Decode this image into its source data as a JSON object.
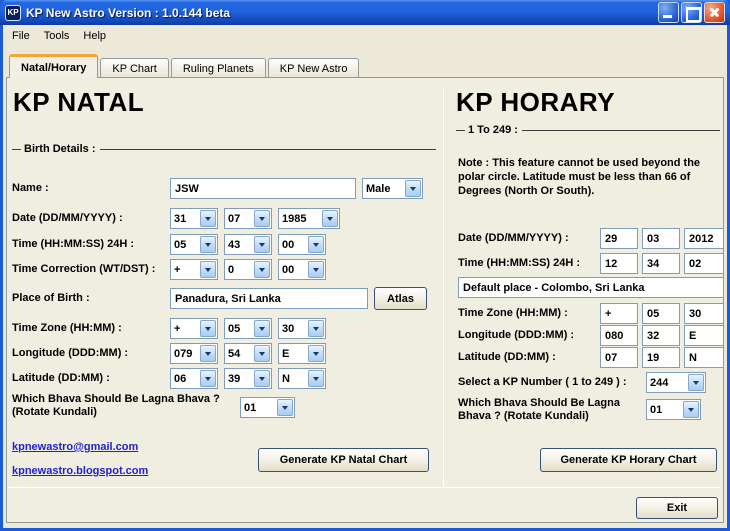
{
  "colors": {
    "titlebar_blue": "#1C5BD8",
    "window_bg": "#ECE9D8",
    "close_red": "#D6492B",
    "link_blue": "#2121CE",
    "textbox_border": "#7F9DB9"
  },
  "window": {
    "icon": "KP",
    "title": "KP New Astro Version : 1.0.144 beta"
  },
  "menu": {
    "items": [
      "File",
      "Tools",
      "Help"
    ]
  },
  "tabs": [
    {
      "label": "Natal/Horary"
    },
    {
      "label": "KP Chart"
    },
    {
      "label": "Ruling Planets"
    },
    {
      "label": "KP New Astro"
    }
  ],
  "natal": {
    "heading": "KP NATAL",
    "group": "Birth Details :",
    "name": {
      "label": "Name :",
      "value": "JSW"
    },
    "gender": {
      "value": "Male"
    },
    "date": {
      "label": "Date (DD/MM/YYYY) :",
      "values": [
        "31",
        "07",
        "1985"
      ]
    },
    "time": {
      "label": "Time (HH:MM:SS) 24H :",
      "values": [
        "05",
        "43",
        "00"
      ]
    },
    "correction": {
      "label": "Time Correction (WT/DST) :",
      "values": [
        "+",
        "0",
        "00"
      ]
    },
    "place": {
      "label": "Place of Birth :",
      "value": "Panadura, Sri Lanka",
      "atlas": "Atlas"
    },
    "zone": {
      "label": "Time Zone (HH:MM) :",
      "values": [
        "+",
        "05",
        "30"
      ]
    },
    "longitude": {
      "label": "Longitude (DDD:MM) :",
      "values": [
        "079",
        "54",
        "E"
      ]
    },
    "latitude": {
      "label": "Latitude (DD:MM) :",
      "values": [
        "06",
        "39",
        "N"
      ]
    },
    "bhava": {
      "line1": "Which Bhava Should Be Lagna Bhava ?",
      "line2": "(Rotate Kundali)",
      "value": "01"
    },
    "email_link": "kpnewastro@gmail.com",
    "blog_link": "kpnewastro.blogspot.com",
    "generate": "Generate KP Natal Chart"
  },
  "horary": {
    "heading": "KP HORARY",
    "subheading": "1 To 249 :",
    "note": "Note : This feature cannot be used beyond the polar circle.  Latitude must be less than 66 of Degrees (North Or South).",
    "date": {
      "label": "Date (DD/MM/YYYY) :",
      "values": [
        "29",
        "03",
        "2012"
      ]
    },
    "time": {
      "label": "Time (HH:MM:SS) 24H :",
      "values": [
        "12",
        "34",
        "02"
      ]
    },
    "place": {
      "value": "Default place - Colombo, Sri Lanka"
    },
    "zone": {
      "label": "Time Zone (HH:MM) :",
      "values": [
        "+",
        "05",
        "30"
      ]
    },
    "longitude": {
      "label": "Longitude (DDD:MM) :",
      "values": [
        "080",
        "32",
        "E"
      ]
    },
    "latitude": {
      "label": "Latitude (DD:MM) :",
      "values": [
        "07",
        "19",
        "N"
      ]
    },
    "kp_number": {
      "label": "Select a KP Number ( 1 to 249 ) :",
      "value": "244"
    },
    "bhava": {
      "line1": "Which Bhava Should Be Lagna",
      "line2": "Bhava ? (Rotate Kundali)",
      "value": "01"
    },
    "generate": "Generate KP Horary Chart"
  },
  "footer": {
    "exit": "Exit"
  }
}
